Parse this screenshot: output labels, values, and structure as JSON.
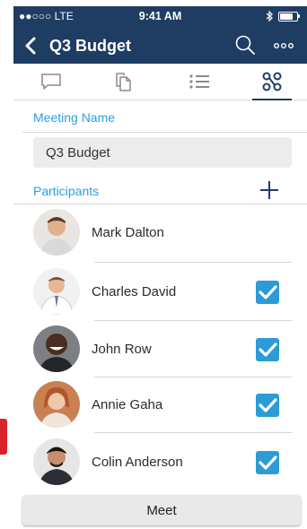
{
  "status_bar": {
    "carrier": "●●○○○ LTE",
    "time": "9:41 AM",
    "battery_level": 0.75,
    "icons": [
      "bluetooth-icon",
      "battery-icon"
    ]
  },
  "nav": {
    "title": "Q3 Budget",
    "icons": [
      "back-chevron-icon",
      "search-icon",
      "more-dots-icon"
    ]
  },
  "tabs": [
    {
      "name": "chat",
      "icon": "chat-bubble-icon",
      "active": false
    },
    {
      "name": "documents",
      "icon": "documents-icon",
      "active": false
    },
    {
      "name": "agenda",
      "icon": "list-icon",
      "active": false
    },
    {
      "name": "participants",
      "icon": "people-network-icon",
      "active": true
    }
  ],
  "meeting": {
    "label": "Meeting Name",
    "value": "Q3 Budget"
  },
  "participants": {
    "label": "Participants",
    "items": [
      {
        "name": "Mark Dalton",
        "checked": false
      },
      {
        "name": "Charles David",
        "checked": true
      },
      {
        "name": "John Row",
        "checked": true
      },
      {
        "name": "Annie Gaha",
        "checked": true
      },
      {
        "name": "Colin Anderson",
        "checked": true
      }
    ]
  },
  "actions": {
    "meet_label": "Meet"
  },
  "colors": {
    "header": "#1f3d63",
    "accent": "#2b9fe0",
    "check": "#2c9bd6",
    "edge_left": "#d9232a",
    "edge_right": "#2ea84a"
  }
}
